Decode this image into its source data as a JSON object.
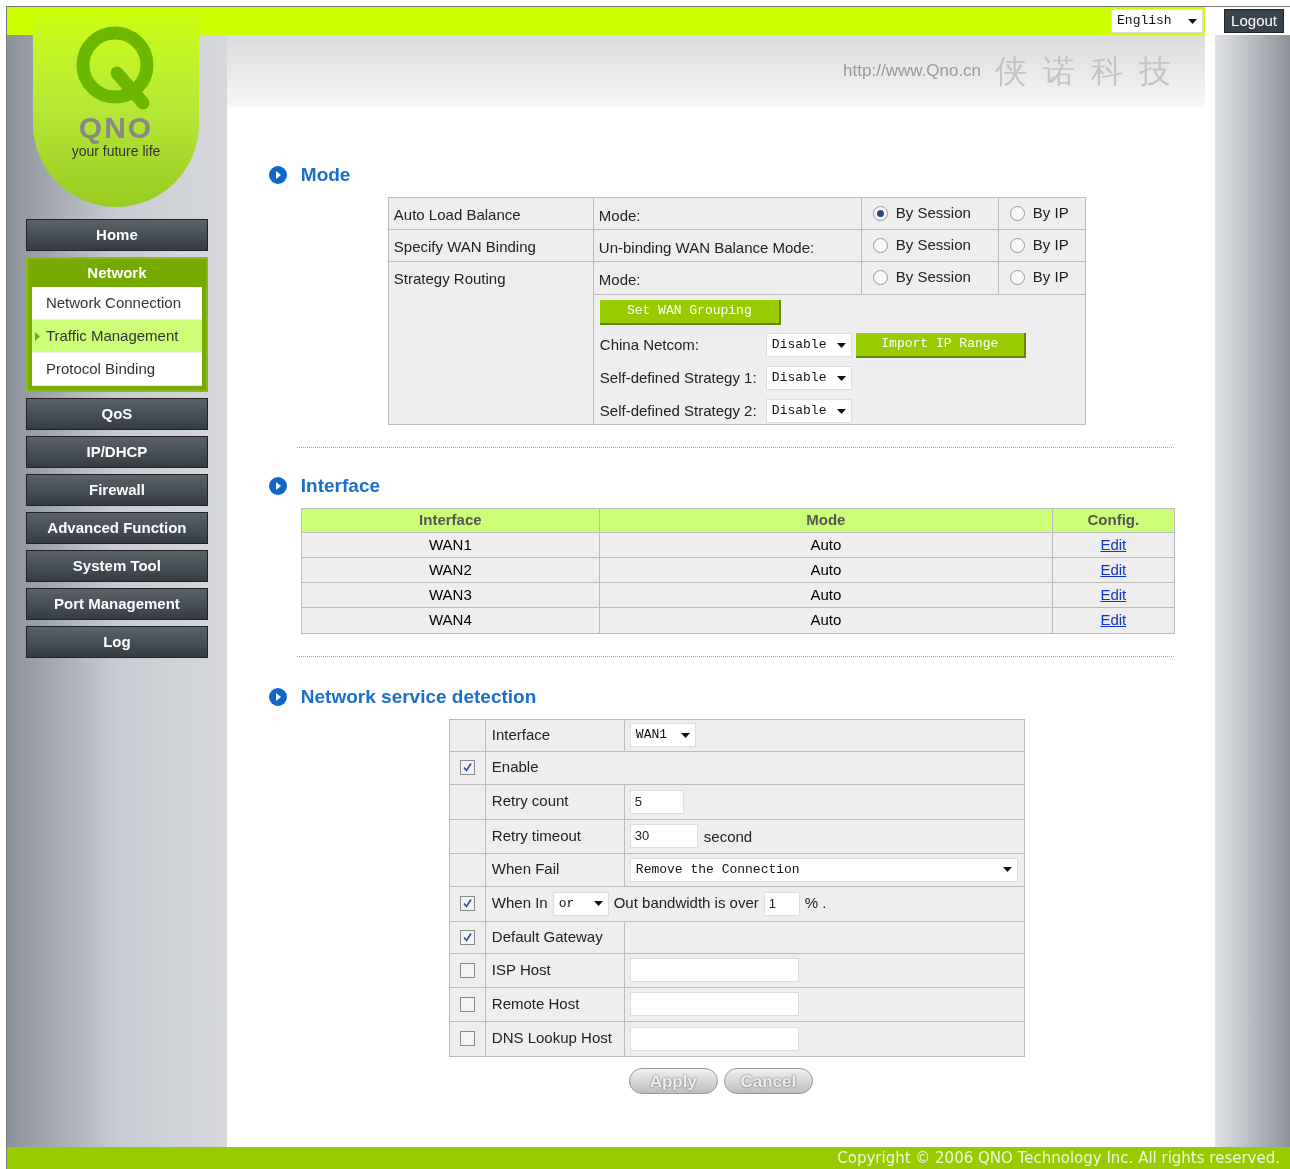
{
  "header": {
    "language": "English",
    "logout": "Logout",
    "url": "http://www.Qno.cn",
    "brand_cn": "侠诺科技"
  },
  "logo": {
    "wordmark": "QNO",
    "tagline": "your future life"
  },
  "sidebar": {
    "items": [
      {
        "label": "Home"
      },
      {
        "label": "Network",
        "expanded": true,
        "children": [
          {
            "label": "Network Connection",
            "selected": false
          },
          {
            "label": "Traffic Management",
            "selected": true
          },
          {
            "label": "Protocol Binding",
            "selected": false
          }
        ]
      },
      {
        "label": "QoS"
      },
      {
        "label": "IP/DHCP"
      },
      {
        "label": "Firewall"
      },
      {
        "label": "Advanced Function"
      },
      {
        "label": "System Tool"
      },
      {
        "label": "Port Management"
      },
      {
        "label": "Log"
      }
    ]
  },
  "mode": {
    "title": "Mode",
    "rows": [
      {
        "label": "Auto Load Balance",
        "mode_label": "Mode:",
        "options": [
          {
            "label": "By Session",
            "selected": true
          },
          {
            "label": "By IP",
            "selected": false
          }
        ]
      },
      {
        "label": "Specify WAN Binding",
        "mode_label": "Un-binding WAN Balance Mode:",
        "options": [
          {
            "label": "By Session",
            "selected": false
          },
          {
            "label": "By IP",
            "selected": false
          }
        ]
      },
      {
        "label": "Strategy Routing",
        "mode_label": "Mode:",
        "options": [
          {
            "label": "By Session",
            "selected": false
          },
          {
            "label": "By IP",
            "selected": false
          }
        ]
      }
    ],
    "grouping_button": "Set WAN Grouping",
    "strategies": [
      {
        "label": "China Netcom:",
        "value": "Disable",
        "button": "Import IP Range"
      },
      {
        "label": "Self-defined Strategy 1:",
        "value": "Disable"
      },
      {
        "label": "Self-defined Strategy 2:",
        "value": "Disable"
      }
    ]
  },
  "interface": {
    "title": "Interface",
    "columns": [
      "Interface",
      "Mode",
      "Config."
    ],
    "rows": [
      {
        "interface": "WAN1",
        "mode": "Auto",
        "config": "Edit"
      },
      {
        "interface": "WAN2",
        "mode": "Auto",
        "config": "Edit"
      },
      {
        "interface": "WAN3",
        "mode": "Auto",
        "config": "Edit"
      },
      {
        "interface": "WAN4",
        "mode": "Auto",
        "config": "Edit"
      }
    ]
  },
  "detection": {
    "title": "Network service detection",
    "rows": [
      {
        "kind": "select",
        "label": "Interface",
        "value": "WAN1"
      },
      {
        "kind": "span",
        "checkbox": {
          "checked": true
        },
        "label": "Enable"
      },
      {
        "kind": "input",
        "label": "Retry count",
        "value": "5"
      },
      {
        "kind": "input",
        "label": "Retry timeout",
        "value": "30",
        "unit": "second"
      },
      {
        "kind": "select_wide",
        "label": "When Fail",
        "value": "Remove the Connection"
      },
      {
        "kind": "bandwidth",
        "checkbox": {
          "checked": true
        },
        "label": "When In",
        "select": "or",
        "text": "Out bandwidth is over",
        "value": "1",
        "unit": "% ."
      },
      {
        "kind": "label",
        "checkbox": {
          "checked": true
        },
        "label": "Default Gateway"
      },
      {
        "kind": "input_wide",
        "checkbox": {
          "checked": false
        },
        "label": "ISP Host"
      },
      {
        "kind": "input_wide",
        "checkbox": {
          "checked": false
        },
        "label": "Remote Host"
      },
      {
        "kind": "input_wide",
        "checkbox": {
          "checked": false
        },
        "label": "DNS Lookup Host"
      }
    ],
    "buttons": [
      "Apply",
      "Cancel"
    ]
  },
  "footer": "Copyright © 2006 QNO Technology Inc. All rights reserved."
}
